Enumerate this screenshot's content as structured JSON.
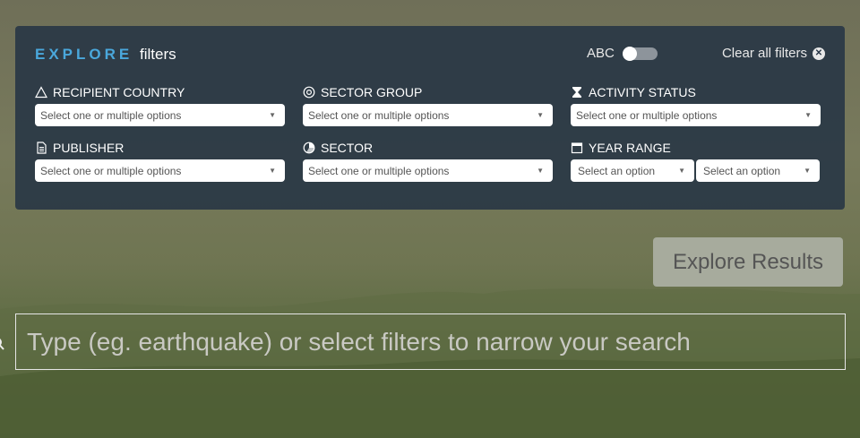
{
  "panel": {
    "title_prefix": "EXPLORE",
    "title_suffix": "filters",
    "toggle_label": "ABC",
    "clear_all": "Clear all filters"
  },
  "filters": [
    {
      "label": "RECIPIENT COUNTRY",
      "icon": "triangle-icon",
      "placeholder": "Select one or multiple options"
    },
    {
      "label": "SECTOR GROUP",
      "icon": "target-icon",
      "placeholder": "Select one or multiple options"
    },
    {
      "label": "ACTIVITY STATUS",
      "icon": "hourglass-icon",
      "placeholder": "Select one or multiple options"
    },
    {
      "label": "PUBLISHER",
      "icon": "document-icon",
      "placeholder": "Select one or multiple options"
    },
    {
      "label": "SECTOR",
      "icon": "pie-chart-icon",
      "placeholder": "Select one or multiple options"
    },
    {
      "label": "YEAR RANGE",
      "icon": "calendar-icon",
      "start_placeholder": "Select an option",
      "end_placeholder": "Select an option"
    }
  ],
  "explore_button": "Explore Results",
  "search": {
    "placeholder": "Type (eg. earthquake) or select filters to narrow your search"
  },
  "colors": {
    "accent": "#4aa8dc",
    "panel_bg": "#263444",
    "button_bg": "#a7ab9d"
  }
}
